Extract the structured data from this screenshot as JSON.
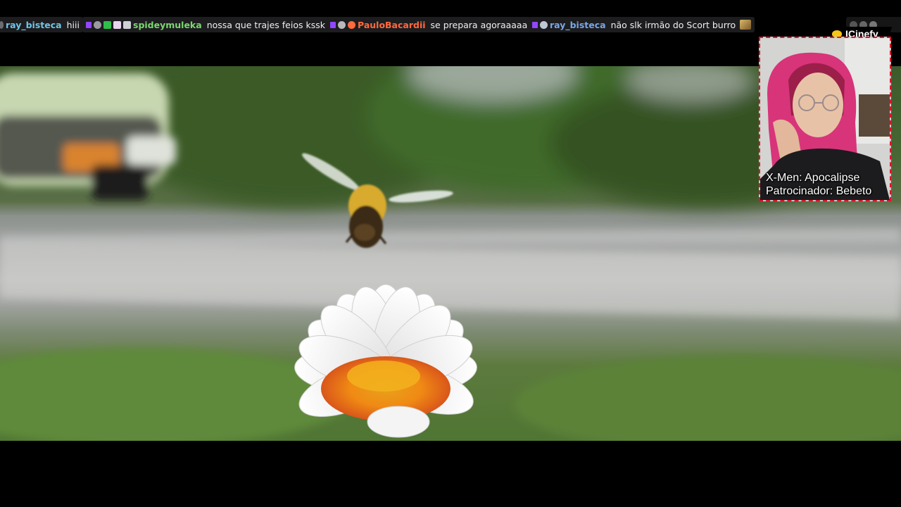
{
  "chat": {
    "messages": [
      {
        "username": "ray_bisteca",
        "text": "hiii",
        "color": "#6ec6e6"
      },
      {
        "username": "spideymuleka",
        "text": "nossa que trajes feios kssk",
        "color": "#7bd86f"
      },
      {
        "username": "PauloBacardii",
        "text": "se prepara agoraaaaa",
        "color": "#ff6a3d"
      },
      {
        "username": "ray_bisteca",
        "text": "não slk irmão do Scort burro",
        "color": "#7aa7e6"
      }
    ]
  },
  "overlay": {
    "logo_text": "ICinefy",
    "caption_line1": "X-Men: Apocalipse",
    "caption_line2": "Patrocinador: Bebeto",
    "border_color": "#e3112a",
    "accent_color": "#f5c518"
  },
  "icons": {
    "sub_badge": "sub-badge-icon",
    "headphones_badge": "headphones-badge-icon",
    "check_badge": "check-badge-icon",
    "emote": "emote-icon"
  }
}
